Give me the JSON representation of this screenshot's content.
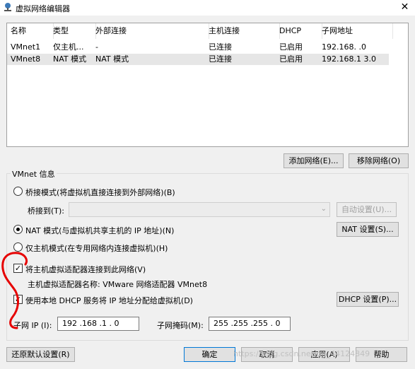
{
  "window": {
    "title": "虚拟网络编辑器",
    "close_glyph": "✕"
  },
  "columns": [
    "名称",
    "类型",
    "外部连接",
    "主机连接",
    "DHCP",
    "子网地址"
  ],
  "networks": [
    {
      "name": "VMnet1",
      "type": "仅主机...",
      "external": "-",
      "host": "已连接",
      "dhcp": "已启用",
      "subnet": "192.168.  .0"
    },
    {
      "name": "VMnet8",
      "type": "NAT 模式",
      "external": "NAT 模式",
      "host": "已连接",
      "dhcp": "已启用",
      "subnet": "192.168.1  3.0"
    }
  ],
  "buttons": {
    "add_network": "添加网络(E)...",
    "remove_network": "移除网络(O)",
    "auto_settings": "自动设置(U)...",
    "nat_settings": "NAT 设置(S)...",
    "dhcp_settings": "DHCP 设置(P)...",
    "restore_defaults": "还原默认设置(R)",
    "ok": "确定",
    "cancel": "取消",
    "apply": "应用(A)",
    "help": "帮助"
  },
  "vmnet_info": {
    "group_label": "VMnet 信息",
    "bridge_mode": "桥接模式(将虚拟机直接连接到外部网络)(B)",
    "bridge_to_label": "桥接到(T):",
    "bridge_to_value": "",
    "nat_mode": "NAT 模式(与虚拟机共享主机的 IP 地址)(N)",
    "host_only_mode": "仅主机模式(在专用网络内连接虚拟机)(H)",
    "selected_mode": "nat",
    "connect_host_adapter": "将主机虚拟适配器连接到此网络(V)",
    "connect_host_adapter_checked": true,
    "host_adapter_name": "主机虚拟适配器名称: VMware 网络适配器 VMnet8",
    "use_dhcp": "使用本地 DHCP 服务将 IP 地址分配给虚拟机(D)",
    "use_dhcp_checked": true,
    "subnet_ip_label": "子网 IP (I):",
    "subnet_ip_value": "192 .168 .1   .  0",
    "subnet_mask_label": "子网掩码(M):",
    "subnet_mask_value": "255 .255 .255 .  0"
  },
  "watermark": "https://blog.csdn.net/qq_44124849",
  "colors": {
    "annotation_red": "#e60000",
    "selection": "#e6e6e6",
    "default_button_border": "#0078d7"
  }
}
